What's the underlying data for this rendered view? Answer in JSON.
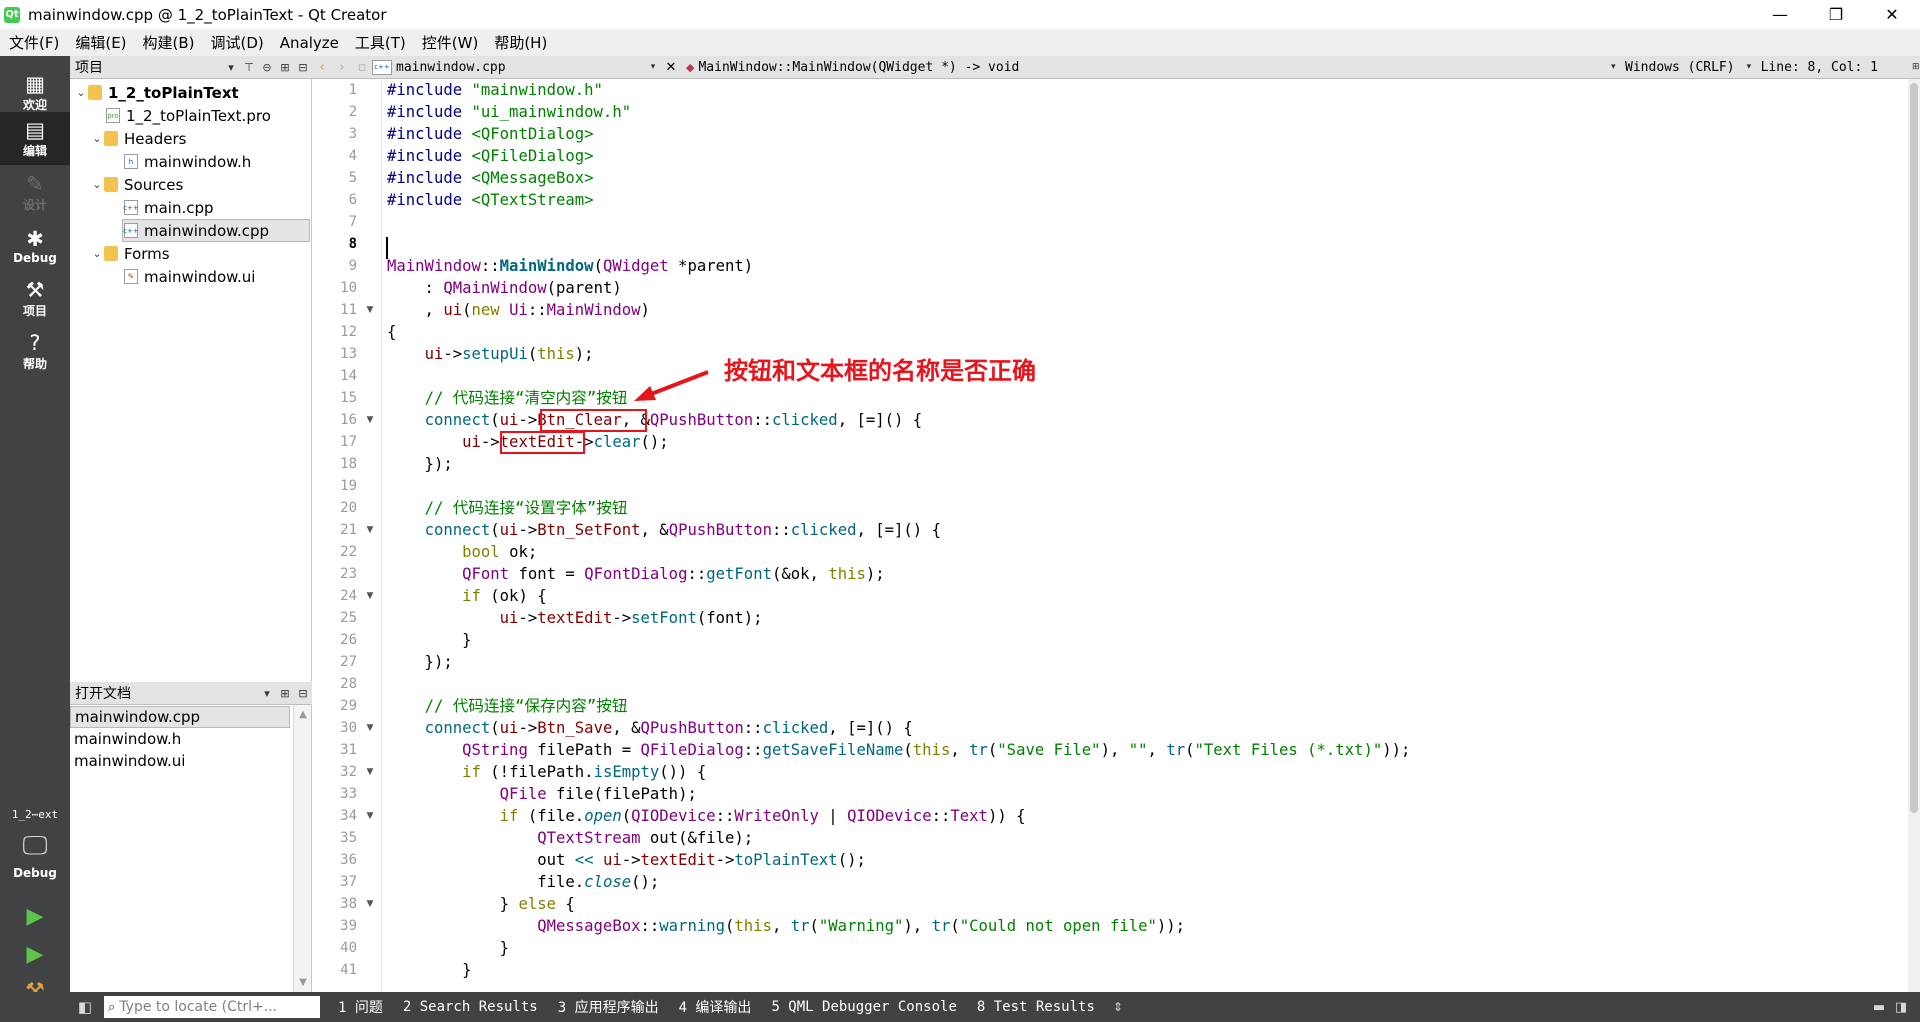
{
  "window": {
    "title": "mainwindow.cpp @ 1_2_toPlainText - Qt Creator",
    "app_icon_text": "Qt",
    "minimize": "—",
    "maximize": "❐",
    "close": "✕"
  },
  "menu": [
    "文件(F)",
    "编辑(E)",
    "构建(B)",
    "调试(D)",
    "Analyze",
    "工具(T)",
    "控件(W)",
    "帮助(H)"
  ],
  "modes": {
    "welcome": "欢迎",
    "edit": "编辑",
    "design": "设计",
    "debug": "Debug",
    "projects": "项目",
    "help": "帮助"
  },
  "kit": {
    "project_label": "1_2⋯ext",
    "build_config": "Debug"
  },
  "project_panel": {
    "title": "项目",
    "tree": [
      {
        "label": "1_2_toPlainText",
        "kind": "root"
      },
      {
        "label": "1_2_toPlainText.pro",
        "kind": "pro"
      },
      {
        "label": "Headers",
        "kind": "folder"
      },
      {
        "label": "mainwindow.h",
        "kind": "header"
      },
      {
        "label": "Sources",
        "kind": "folder"
      },
      {
        "label": "main.cpp",
        "kind": "cpp"
      },
      {
        "label": "mainwindow.cpp",
        "kind": "cpp",
        "selected": true
      },
      {
        "label": "Forms",
        "kind": "folder"
      },
      {
        "label": "mainwindow.ui",
        "kind": "ui"
      }
    ]
  },
  "open_docs": {
    "title": "打开文档",
    "items": [
      "mainwindow.cpp",
      "mainwindow.h",
      "mainwindow.ui"
    ]
  },
  "editor_toolbar": {
    "file": "mainwindow.cpp",
    "symbol": "MainWindow::MainWindow(QWidget *) -> void",
    "encoding": "Windows (CRLF)",
    "position": "Line: 8, Col: 1"
  },
  "editor": {
    "line_numbers": [
      "1",
      "2",
      "3",
      "4",
      "5",
      "6",
      "7",
      "8",
      "9",
      "10",
      "11",
      "12",
      "13",
      "14",
      "15",
      "16",
      "17",
      "18",
      "19",
      "20",
      "21",
      "22",
      "23",
      "24",
      "25",
      "26",
      "27",
      "28",
      "29",
      "30",
      "31",
      "32",
      "33",
      "34",
      "35",
      "36",
      "37",
      "38",
      "39",
      "40",
      "41"
    ],
    "current_line": "8",
    "fold_lines": [
      "11",
      "16",
      "21",
      "24",
      "30",
      "32",
      "34",
      "38"
    ],
    "code": {
      "l1a": "#include ",
      "l1b": "\"mainwindow.h\"",
      "l2a": "#include ",
      "l2b": "\"ui_mainwindow.h\"",
      "l3a": "#include ",
      "l3b": "<QFontDialog>",
      "l4a": "#include ",
      "l4b": "<QFileDialog>",
      "l5a": "#include ",
      "l5b": "<QMessageBox>",
      "l6a": "#include ",
      "l6b": "<QTextStream>",
      "mw": "MainWindow",
      "sep": "::",
      "mw2": "MainWindow",
      "qwidget": "QWidget",
      "parent_arg": " *parent)",
      "qmw": "QMainWindow",
      "parent": "parent",
      "ui": "ui",
      "new": "new",
      "ui_ns": "Ui",
      "mw3": "MainWindow",
      "setupUi": "setupUi",
      "this": "this",
      "c15": "// 代码连接“清空内容”按钮",
      "connect": "connect",
      "btn_clear": "Btn_Clear",
      "qpb": "QPushButton",
      "clicked": "clicked",
      "textEdit": "textEdit",
      "clear": "clear",
      "c20": "// 代码连接“设置字体”按钮",
      "btn_setfont": "Btn_SetFont",
      "bool": "bool",
      "ok": "ok",
      "qfont": "QFont",
      "font": "font",
      "qfontdialog": "QFontDialog",
      "getFont": "getFont",
      "if": "if",
      "setFont": "setFont",
      "c29": "// 代码连接“保存内容”按钮",
      "btn_save": "Btn_Save",
      "qstring": "QString",
      "filePath": "filePath",
      "qfiledialog": "QFileDialog",
      "getSaveFileName": "getSaveFileName",
      "tr": "tr",
      "save_file": "\"Save File\"",
      "empty": "\"\"",
      "text_files": "\"Text Files (*.txt)\"",
      "isEmpty": "isEmpty",
      "qfile": "QFile",
      "file": "file",
      "open": "open",
      "qiodevice": "QIODevice",
      "writeonly": "WriteOnly",
      "text": "Text",
      "qtextstream": "QTextStream",
      "out": "out",
      "toPlainText": "toPlainText",
      "close": "close",
      "else": "else",
      "qmessagebox": "QMessageBox",
      "warning": "warning",
      "warning_str": "\"Warning\"",
      "could_not": "\"Could not open file\""
    }
  },
  "annotation": "按钮和文本框的名称是否正确",
  "status_bar": {
    "locator_placeholder": "Type to locate (Ctrl+...",
    "tabs": [
      "1 问题",
      "2 Search Results",
      "3 应用程序输出",
      "4 编译输出",
      "5 QML Debugger Console",
      "8 Test Results"
    ]
  },
  "colors": {
    "modebar": "#404244",
    "accent_red": "#e8141c",
    "preprocessor": "#000080",
    "string": "#008000",
    "keyword": "#808000",
    "type": "#800080",
    "function": "#00677c",
    "member": "#800000"
  },
  "icons": [
    "qt-logo-icon",
    "welcome-grid-icon",
    "edit-icon",
    "design-pencil-icon",
    "debug-bug-icon",
    "wrench-icon",
    "help-icon",
    "monitor-icon",
    "run-icon",
    "debug-run-icon",
    "hammer-icon",
    "search-icon",
    "filter-icon",
    "link-icon",
    "split-icon",
    "close-icon"
  ]
}
